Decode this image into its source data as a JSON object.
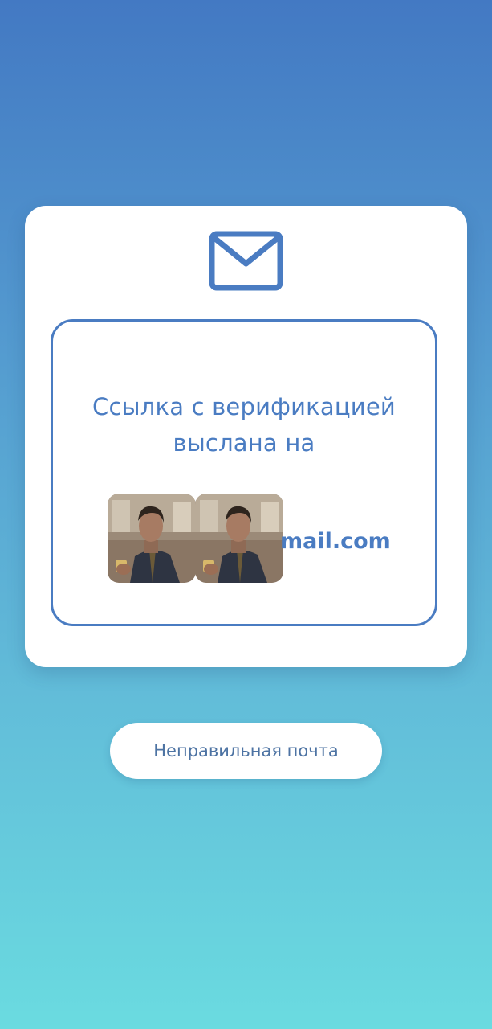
{
  "card": {
    "icon": "envelope-icon",
    "message": "Ссылка с верификацией выслана на",
    "email_suffix": "mail.com",
    "avatar_icon": "person-photo-avatar"
  },
  "wrong_email_button": {
    "label": "Неправильная почта"
  },
  "colors": {
    "accent": "#4a7cc2",
    "button_text": "#4d73a3",
    "background_top": "#4379c3",
    "background_bottom": "#6adbe0",
    "card_background": "#ffffff"
  }
}
